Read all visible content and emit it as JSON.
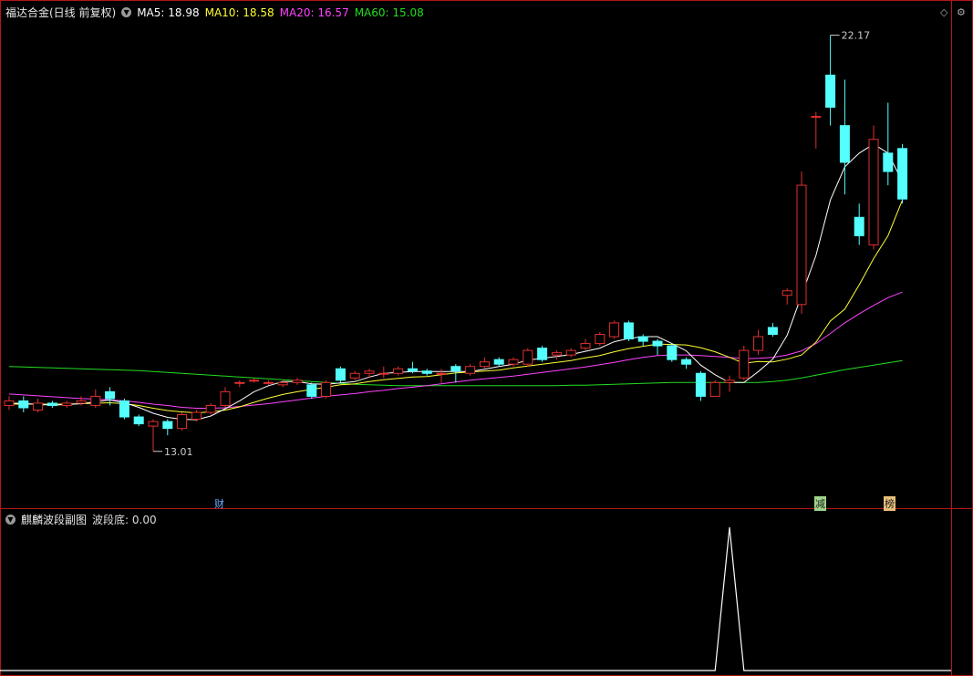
{
  "header": {
    "title": "福达合金(日线 前复权)",
    "ma5": "MA5: 18.98",
    "ma10": "MA10: 18.58",
    "ma20": "MA20: 16.57",
    "ma60": "MA60: 15.08"
  },
  "sub_header": {
    "title": "麒麟波段副图",
    "value": "波段底: 0.00"
  },
  "annotations": {
    "high_label": "22.17",
    "low_label": "13.01",
    "mark_cai": "财",
    "mark_jian": "减",
    "mark_bang": "榜"
  },
  "icons": {
    "collapse": "chevron-down-icon",
    "diamond": "diamond-icon",
    "settings": "gear-icon"
  },
  "colors": {
    "up": "#e03030",
    "down": "#54ffff",
    "ma5": "#ffffff",
    "ma10": "#ffff33",
    "ma20": "#ff44ff",
    "ma60": "#22dd22",
    "frame": "#b01818"
  },
  "chart_data": [
    {
      "type": "candlestick",
      "title": "福达合金(日线 前复权)",
      "ylim": [
        12.3,
        22.5
      ],
      "candles": [
        [
          14.1,
          14.2,
          14.3,
          14.0
        ],
        [
          14.2,
          14.05,
          14.3,
          13.95
        ],
        [
          14.0,
          14.15,
          14.25,
          13.95
        ],
        [
          14.15,
          14.1,
          14.2,
          14.05
        ],
        [
          14.1,
          14.15,
          14.2,
          14.05
        ],
        [
          14.15,
          14.2,
          14.3,
          14.1
        ],
        [
          14.1,
          14.3,
          14.45,
          14.05
        ],
        [
          14.4,
          14.25,
          14.5,
          14.1
        ],
        [
          14.2,
          13.85,
          14.25,
          13.8
        ],
        [
          13.85,
          13.7,
          13.9,
          13.65
        ],
        [
          13.65,
          13.75,
          13.8,
          13.1
        ],
        [
          13.75,
          13.6,
          13.8,
          13.45
        ],
        [
          13.6,
          13.9,
          13.95,
          13.55
        ],
        [
          13.8,
          13.95,
          14.0,
          13.75
        ],
        [
          13.95,
          14.1,
          14.15,
          13.9
        ],
        [
          14.1,
          14.4,
          14.5,
          14.05
        ],
        [
          14.6,
          14.6,
          14.65,
          14.5
        ],
        [
          14.65,
          14.65,
          14.7,
          14.6
        ],
        [
          14.6,
          14.6,
          14.65,
          14.55
        ],
        [
          14.55,
          14.6,
          14.65,
          14.5
        ],
        [
          14.6,
          14.65,
          14.7,
          14.55
        ],
        [
          14.55,
          14.3,
          14.6,
          14.25
        ],
        [
          14.3,
          14.6,
          14.65,
          14.25
        ],
        [
          14.9,
          14.65,
          14.95,
          14.6
        ],
        [
          14.7,
          14.8,
          14.85,
          14.65
        ],
        [
          14.8,
          14.85,
          14.9,
          14.7
        ],
        [
          14.8,
          14.8,
          14.95,
          14.7
        ],
        [
          14.8,
          14.9,
          14.95,
          14.75
        ],
        [
          14.9,
          14.85,
          15.05,
          14.8
        ],
        [
          14.85,
          14.8,
          14.9,
          14.75
        ],
        [
          14.8,
          14.8,
          14.9,
          14.6
        ],
        [
          14.95,
          14.85,
          15.0,
          14.6
        ],
        [
          14.8,
          14.95,
          15.0,
          14.75
        ],
        [
          14.95,
          15.05,
          15.15,
          14.9
        ],
        [
          15.1,
          15.0,
          15.15,
          14.95
        ],
        [
          15.0,
          15.1,
          15.15,
          14.95
        ],
        [
          15.0,
          15.3,
          15.35,
          14.95
        ],
        [
          15.35,
          15.1,
          15.4,
          15.05
        ],
        [
          15.2,
          15.25,
          15.3,
          15.1
        ],
        [
          15.2,
          15.3,
          15.35,
          15.15
        ],
        [
          15.35,
          15.45,
          15.55,
          15.3
        ],
        [
          15.45,
          15.65,
          15.7,
          15.4
        ],
        [
          15.6,
          15.9,
          15.95,
          15.55
        ],
        [
          15.9,
          15.55,
          15.95,
          15.5
        ],
        [
          15.6,
          15.5,
          15.65,
          15.4
        ],
        [
          15.5,
          15.4,
          15.55,
          15.2
        ],
        [
          15.4,
          15.1,
          15.45,
          15.05
        ],
        [
          15.1,
          15.0,
          15.15,
          14.9
        ],
        [
          14.8,
          14.3,
          14.85,
          14.2
        ],
        [
          14.3,
          14.6,
          14.65,
          14.3
        ],
        [
          14.6,
          14.65,
          14.75,
          14.4
        ],
        [
          14.7,
          15.3,
          15.4,
          14.65
        ],
        [
          15.3,
          15.6,
          15.75,
          15.2
        ],
        [
          15.8,
          15.65,
          15.9,
          15.6
        ],
        [
          16.5,
          16.6,
          16.65,
          16.3
        ],
        [
          16.3,
          18.9,
          19.2,
          16.1
        ],
        [
          20.4,
          20.4,
          20.5,
          19.7
        ],
        [
          21.3,
          20.6,
          22.17,
          20.2
        ],
        [
          20.2,
          19.4,
          21.2,
          18.7
        ],
        [
          18.2,
          17.8,
          18.5,
          17.6
        ],
        [
          17.6,
          19.9,
          20.2,
          17.5
        ],
        [
          19.6,
          19.2,
          20.7,
          18.9
        ],
        [
          19.7,
          18.6,
          19.8,
          18.5
        ]
      ],
      "ma": {
        "MA5": [
          14.15,
          14.15,
          14.12,
          14.11,
          14.12,
          14.14,
          14.18,
          14.22,
          14.16,
          14.06,
          13.93,
          13.84,
          13.8,
          13.79,
          13.87,
          14.03,
          14.2,
          14.4,
          14.53,
          14.62,
          14.62,
          14.57,
          14.56,
          14.59,
          14.62,
          14.72,
          14.8,
          14.82,
          14.84,
          14.84,
          14.84,
          14.84,
          14.84,
          14.89,
          14.95,
          15.0,
          15.09,
          15.13,
          15.17,
          15.21,
          15.28,
          15.35,
          15.49,
          15.56,
          15.6,
          15.6,
          15.45,
          15.29,
          14.98,
          14.77,
          14.6,
          14.6,
          14.84,
          15.11,
          15.63,
          16.5,
          17.37,
          18.58,
          19.3,
          19.6,
          19.8,
          19.6,
          18.98
        ],
        "MA10": [
          14.13,
          14.13,
          14.13,
          14.13,
          14.13,
          14.14,
          14.15,
          14.16,
          14.14,
          14.1,
          14.04,
          13.99,
          13.96,
          13.94,
          13.96,
          14.0,
          14.07,
          14.17,
          14.26,
          14.34,
          14.4,
          14.45,
          14.5,
          14.55,
          14.57,
          14.62,
          14.66,
          14.69,
          14.72,
          14.73,
          14.77,
          14.81,
          14.83,
          14.85,
          14.87,
          14.92,
          14.96,
          15.0,
          15.04,
          15.08,
          15.14,
          15.19,
          15.27,
          15.34,
          15.39,
          15.44,
          15.43,
          15.42,
          15.36,
          15.27,
          15.15,
          15.02,
          15.06,
          15.05,
          15.11,
          15.2,
          15.48,
          15.94,
          16.2,
          16.73,
          17.3,
          17.8,
          18.58
        ],
        "MA20": [
          14.35,
          14.33,
          14.31,
          14.29,
          14.27,
          14.25,
          14.24,
          14.22,
          14.2,
          14.17,
          14.13,
          14.1,
          14.06,
          14.04,
          14.04,
          14.05,
          14.08,
          14.11,
          14.14,
          14.18,
          14.22,
          14.26,
          14.3,
          14.33,
          14.36,
          14.4,
          14.43,
          14.47,
          14.5,
          14.53,
          14.57,
          14.61,
          14.65,
          14.68,
          14.71,
          14.74,
          14.78,
          14.82,
          14.86,
          14.9,
          14.94,
          14.99,
          15.04,
          15.1,
          15.15,
          15.19,
          15.2,
          15.2,
          15.19,
          15.17,
          15.15,
          15.12,
          15.13,
          15.15,
          15.2,
          15.29,
          15.45,
          15.67,
          15.9,
          16.1,
          16.28,
          16.45,
          16.57
        ],
        "MA60": [
          14.95,
          14.94,
          14.93,
          14.92,
          14.91,
          14.9,
          14.89,
          14.88,
          14.87,
          14.86,
          14.84,
          14.82,
          14.8,
          14.78,
          14.76,
          14.74,
          14.72,
          14.7,
          14.68,
          14.66,
          14.64,
          14.62,
          14.6,
          14.58,
          14.56,
          14.55,
          14.54,
          14.53,
          14.53,
          14.53,
          14.53,
          14.53,
          14.53,
          14.53,
          14.53,
          14.53,
          14.53,
          14.53,
          14.53,
          14.54,
          14.54,
          14.55,
          14.56,
          14.57,
          14.58,
          14.59,
          14.6,
          14.6,
          14.6,
          14.6,
          14.6,
          14.6,
          14.6,
          14.62,
          14.65,
          14.7,
          14.76,
          14.82,
          14.88,
          14.93,
          14.98,
          15.03,
          15.08
        ]
      }
    },
    {
      "type": "line",
      "title": "麒麟波段副图",
      "series": [
        {
          "name": "波段底",
          "values": [
            0,
            0,
            0,
            0,
            0,
            0,
            0,
            0,
            0,
            0,
            0,
            0,
            0,
            0,
            0,
            0,
            0,
            0,
            0,
            0,
            0,
            0,
            0,
            0,
            0,
            0,
            0,
            0,
            0,
            0,
            0,
            0,
            0,
            0,
            0,
            0,
            0,
            0,
            0,
            0,
            0,
            0,
            0,
            0,
            0,
            0,
            0,
            0,
            0,
            0,
            1,
            0,
            0,
            0,
            0,
            0,
            0,
            0,
            0,
            0,
            0,
            0,
            0
          ]
        }
      ],
      "ylim": [
        0,
        1
      ]
    }
  ]
}
